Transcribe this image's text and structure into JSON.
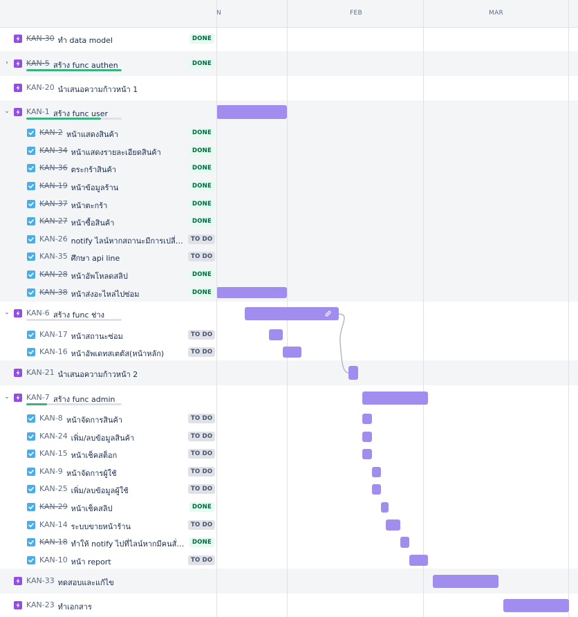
{
  "timeline": {
    "months": [
      "N",
      "FEB",
      "MAR"
    ]
  },
  "issues": [
    {
      "key": "KAN-30",
      "summary": "ทำ data model",
      "status": "DONE",
      "type": "epic"
    },
    {
      "key": "KAN-5",
      "summary": "สร้าง func authen",
      "status": "DONE",
      "type": "epic",
      "progress": 1.0
    },
    {
      "key": "KAN-20",
      "summary": "นำเสนอความก้าวหน้า 1",
      "status": "",
      "type": "epic"
    },
    {
      "key": "KAN-1",
      "summary": "สร้าง func user",
      "status": "",
      "type": "epic",
      "progress": 0.78
    },
    {
      "key": "KAN-2",
      "summary": "หน้าแสดงสินค้า",
      "status": "DONE",
      "type": "task"
    },
    {
      "key": "KAN-34",
      "summary": "หน้าแสดงรายละเอียดสินค้า",
      "status": "DONE",
      "type": "task"
    },
    {
      "key": "KAN-36",
      "summary": "ตระกร้าสินค้า",
      "status": "DONE",
      "type": "task"
    },
    {
      "key": "KAN-19",
      "summary": "หน้าข้อมูลร้าน",
      "status": "DONE",
      "type": "task"
    },
    {
      "key": "KAN-37",
      "summary": "หน้าตะกร้า",
      "status": "DONE",
      "type": "task"
    },
    {
      "key": "KAN-27",
      "summary": "หน้าซื้อสินค้า",
      "status": "DONE",
      "type": "task"
    },
    {
      "key": "KAN-26",
      "summary": "notify ไลน์หากสถานะมีการเปลี่ยน...",
      "status": "TO DO",
      "type": "task"
    },
    {
      "key": "KAN-35",
      "summary": "ศึกษา api line",
      "status": "TO DO",
      "type": "task"
    },
    {
      "key": "KAN-28",
      "summary": "หน้าอัพโหลดสลิป",
      "status": "DONE",
      "type": "task"
    },
    {
      "key": "KAN-38",
      "summary": "หน้าส่งอะไหล่ไปซ่อม",
      "status": "DONE",
      "type": "task"
    },
    {
      "key": "KAN-6",
      "summary": "สร้าง func ช่าง",
      "status": "",
      "type": "epic",
      "progress": 0.0
    },
    {
      "key": "KAN-17",
      "summary": "หน้าสถานะซ่อม",
      "status": "TO DO",
      "type": "task"
    },
    {
      "key": "KAN-16",
      "summary": "หน้าอัพเดทสเตตัส(หน้าหลัก)",
      "status": "TO DO",
      "type": "task"
    },
    {
      "key": "KAN-21",
      "summary": "นำเสนอความก้าวหน้า 2",
      "status": "",
      "type": "epic"
    },
    {
      "key": "KAN-7",
      "summary": "สร้าง func admin",
      "status": "",
      "type": "epic",
      "progress": 0.22
    },
    {
      "key": "KAN-8",
      "summary": "หน้าจัดการสินค้า",
      "status": "TO DO",
      "type": "task"
    },
    {
      "key": "KAN-24",
      "summary": "เพิ่ม/ลบข้อมูลสินค้า",
      "status": "TO DO",
      "type": "task"
    },
    {
      "key": "KAN-15",
      "summary": "หน้าเช็คสต็อก",
      "status": "TO DO",
      "type": "task"
    },
    {
      "key": "KAN-9",
      "summary": "หน้าจัดการผู้ใช้",
      "status": "TO DO",
      "type": "task"
    },
    {
      "key": "KAN-25",
      "summary": "เพิ่ม/ลบข้อมูลผู้ใช้",
      "status": "TO DO",
      "type": "task"
    },
    {
      "key": "KAN-29",
      "summary": "หน้าเช็คสลิป",
      "status": "DONE",
      "type": "task"
    },
    {
      "key": "KAN-14",
      "summary": "ระบบขายหน้าร้าน",
      "status": "TO DO",
      "type": "task"
    },
    {
      "key": "KAN-18",
      "summary": "ทำให้ notify ไปที่ไลน์หากมีคนสั่งซื้อ",
      "status": "DONE",
      "type": "task"
    },
    {
      "key": "KAN-10",
      "summary": "หน้า report",
      "status": "TO DO",
      "type": "task"
    },
    {
      "key": "KAN-33",
      "summary": "ทดสอบและแก้ไข",
      "status": "",
      "type": "epic"
    },
    {
      "key": "KAN-23",
      "summary": "ทำเอกสาร",
      "status": "",
      "type": "epic"
    }
  ],
  "colors": {
    "epic_icon": "#904ee2",
    "task_icon": "#4bade8",
    "bar": "#a18ded",
    "done_text": "#006644",
    "done_bg": "#e3fcef",
    "todo_bg": "#dfe1e6",
    "progress": "#36b37e"
  },
  "icons": {
    "epic": "lightning-icon",
    "task": "checkbox-icon",
    "expand": "chevron-right-icon",
    "collapse": "chevron-down-icon",
    "link": "link-icon"
  }
}
